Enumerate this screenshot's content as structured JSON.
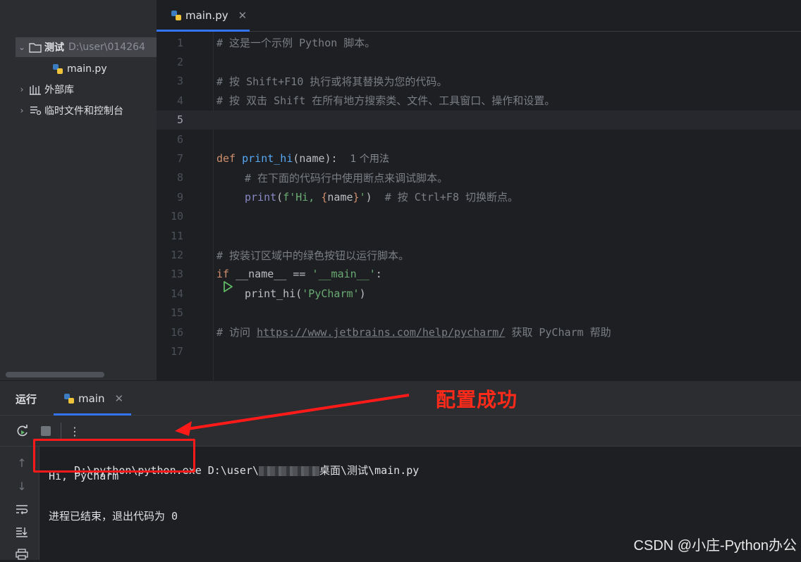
{
  "project_tree": {
    "root_label": "测试",
    "root_path": "D:\\user\\014264",
    "file_label": "main.py",
    "external_libs": "外部库",
    "scratches": "临时文件和控制台"
  },
  "editor": {
    "tab_label": "main.py",
    "current_line": 5,
    "lines": [
      {
        "n": "1"
      },
      {
        "n": "2"
      },
      {
        "n": "3"
      },
      {
        "n": "4"
      },
      {
        "n": "5"
      },
      {
        "n": "6"
      },
      {
        "n": "7"
      },
      {
        "n": "8"
      },
      {
        "n": "9"
      },
      {
        "n": "10"
      },
      {
        "n": "11"
      },
      {
        "n": "12"
      },
      {
        "n": "13"
      },
      {
        "n": "14"
      },
      {
        "n": "15"
      },
      {
        "n": "16"
      },
      {
        "n": "17"
      }
    ],
    "code": {
      "l1": "# 这是一个示例 Python 脚本。",
      "l3": "# 按 Shift+F10 执行或将其替换为您的代码。",
      "l4": "# 按 双击 Shift 在所有地方搜索类、文件、工具窗口、操作和设置。",
      "l7_def": "def",
      "l7_fn": "print_hi",
      "l7_args": "(name):",
      "l7_hint": "1 个用法",
      "l8": "# 在下面的代码行中使用断点来调试脚本。",
      "l9_print": "print",
      "l9_open": "(",
      "l9_str1": "f'Hi, ",
      "l9_brace_o": "{",
      "l9_name": "name",
      "l9_brace_c": "}",
      "l9_str2": "'",
      "l9_close": ")",
      "l9_comment": "# 按 Ctrl+F8 切换断点。",
      "l12": "# 按装订区域中的绿色按钮以运行脚本。",
      "l13_if": "if",
      "l13_mid": " __name__ == ",
      "l13_str": "'__main__'",
      "l13_colon": ":",
      "l14_call": "print_hi(",
      "l14_str": "'PyCharm'",
      "l14_close": ")",
      "l16_pre": "# 访问 ",
      "l16_url": "https://www.jetbrains.com/help/pycharm/",
      "l16_post": " 获取 PyCharm 帮助"
    }
  },
  "run_panel": {
    "title": "运行",
    "tab_label": "main",
    "console": {
      "exe": "D:\\python\\python.exe",
      "arg_prefix": " D:\\user\\",
      "arg_suffix": "桌面\\测试\\main.py",
      "output": "Hi, PyCharm",
      "exit_message": "进程已结束，退出代码为 0"
    }
  },
  "annotation": {
    "text": "配置成功",
    "color": "#ff1a1a"
  },
  "watermark": "CSDN @小庄-Python办公"
}
